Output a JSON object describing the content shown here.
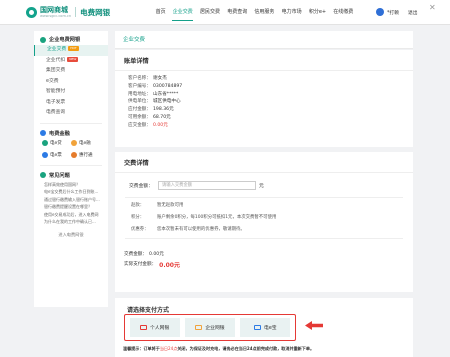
{
  "header": {
    "logo_title": "国网商城",
    "logo_subtitle": "www.sgcc.com.cn",
    "logo_brand": "电费网银",
    "nav": [
      "首页",
      "企业交费",
      "居民交费",
      "电费查询",
      "信用服务",
      "电力市场",
      "积分e+",
      "在线缴费"
    ],
    "active_index": 1,
    "user_name": "*打赖",
    "exit_label": "退出"
  },
  "sidebar": {
    "section1_title": "企业电费网银",
    "items": [
      {
        "label": "企业交费",
        "badge": "HOT"
      },
      {
        "label": "企业代扣",
        "badge": "NEW"
      },
      {
        "label": "集团交费",
        "badge": ""
      },
      {
        "label": "e交费",
        "badge": ""
      },
      {
        "label": "智能预付",
        "badge": ""
      },
      {
        "label": "电子发票",
        "badge": ""
      },
      {
        "label": "电费查询",
        "badge": ""
      }
    ],
    "section2_title": "电费金融",
    "finance": [
      "电e贷",
      "电e融",
      "电e票",
      "惠行通"
    ],
    "section3_title": "常见问题",
    "faqs": [
      "怎样高效使用国网？",
      "电e宝交费后什么工作日到账...",
      "通过银行缴费输入银行账户号...",
      "银行缴费提醒设置在哪里？",
      "使用e交易成功后，进入电费网",
      "为什么在我的工作中确认已..."
    ],
    "more_label": "进入电费网银"
  },
  "breadcrumb": "企业交费",
  "account": {
    "title": "账单详情",
    "rows": [
      {
        "label": "客户名称：",
        "value": "谢女杰",
        "red": false
      },
      {
        "label": "客户编号：",
        "value": "0300784897",
        "red": false
      },
      {
        "label": "用电地址：",
        "value": "山东省*****",
        "red": false
      },
      {
        "label": "供电单位：",
        "value": "城区供电中心",
        "red": false
      },
      {
        "label": "应付金额：",
        "value": "198.36元",
        "red": false
      },
      {
        "label": "可用余额：",
        "value": "68.70元",
        "red": false
      },
      {
        "label": "应交金额：",
        "value": "0.00元",
        "red": true
      }
    ]
  },
  "payment": {
    "title": "交费详情",
    "amount_label": "交费金额：",
    "amount_placeholder": "请输入交费金额",
    "amount_unit": "元",
    "tips": [
      {
        "label": "赵款：",
        "value": "暂无赵款可用"
      },
      {
        "label": "积分：",
        "value": "账户剩余0积分，每100积分可抵扣1元，本次交费暂不可使用"
      },
      {
        "label": "优惠券：",
        "value": "您本次暂未有可以使用的优惠券，敬请期待。"
      }
    ],
    "fee_label": "交费金额：",
    "fee_value": "0.00元",
    "due_label": "实际支付金额：",
    "due_value": "0.00元"
  },
  "pay_method": {
    "title": "请选择支付方式",
    "options": [
      "个人网银",
      "企业网银",
      "电e宝"
    ],
    "warning_prefix": "温馨提示：订单将于",
    "warning_highlight": "当日24点",
    "warning_suffix": "关闭，为保证及时充电，请务必在当日24点前完成付款，取消并重新下单。"
  },
  "colors": {
    "accent": "#14a08a",
    "highlight": "#e53935",
    "link": "#2c7be5"
  }
}
